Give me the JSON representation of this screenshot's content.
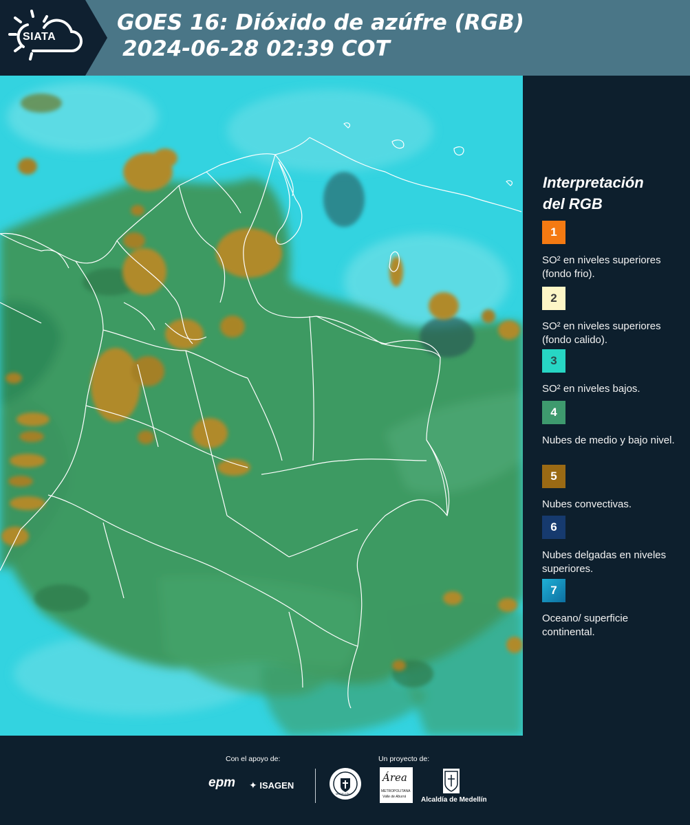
{
  "header": {
    "logo_text": "SIATA",
    "title_line1": "GOES 16: Dióxido de azúfre (RGB)",
    "title_line2": "2024-06-28 02:39 COT"
  },
  "legend": {
    "title_line1": "Interpretación",
    "title_line2": "del RGB",
    "items": [
      {
        "number": "1",
        "label": "SO² en niveles superiores (fondo frio).",
        "color": "#f47a12",
        "text_color": "#ffffff"
      },
      {
        "number": "2",
        "label": "SO² en niveles superiores (fondo calido).",
        "color": "#fdf6c6",
        "text_color": "#3a3a3a"
      },
      {
        "number": "3",
        "label": "SO² en niveles bajos.",
        "color": "#27d6c4",
        "text_color": "#2a4a4a"
      },
      {
        "number": "4",
        "label": "Nubes de medio y bajo nivel.",
        "color": "#3e9a6e",
        "text_color": "#ffffff"
      },
      {
        "number": "5",
        "label": "Nubes convectivas.",
        "color": "#9a6a14",
        "text_color": "#ffffff"
      },
      {
        "number": "6",
        "label": "Nubes delgadas en niveles superiores.",
        "color": "#163a6e",
        "text_color": "#ffffff"
      },
      {
        "number": "7",
        "label": "Oceano/ superficie continental.",
        "color": "#138fc0",
        "text_color": "#ffffff"
      }
    ]
  },
  "map": {
    "ocean_color": "#33d3e0",
    "cloud_green": "#3d9a62",
    "convective_brown": "#b08a2a",
    "border_color": "#ffffff"
  },
  "footer": {
    "support_label": "Con el apoyo de:",
    "project_label": "Un proyecto de:",
    "sponsor_epm": "epm",
    "sponsor_isagen": "ISAGEN",
    "area_logo_word": "Área",
    "area_caption_1": "METROPOLITANA",
    "area_caption_2": "Valle de Aburrá",
    "alcaldia_caption": "Alcaldía de Medellín",
    "seal_text": "MEDELLÍN"
  }
}
